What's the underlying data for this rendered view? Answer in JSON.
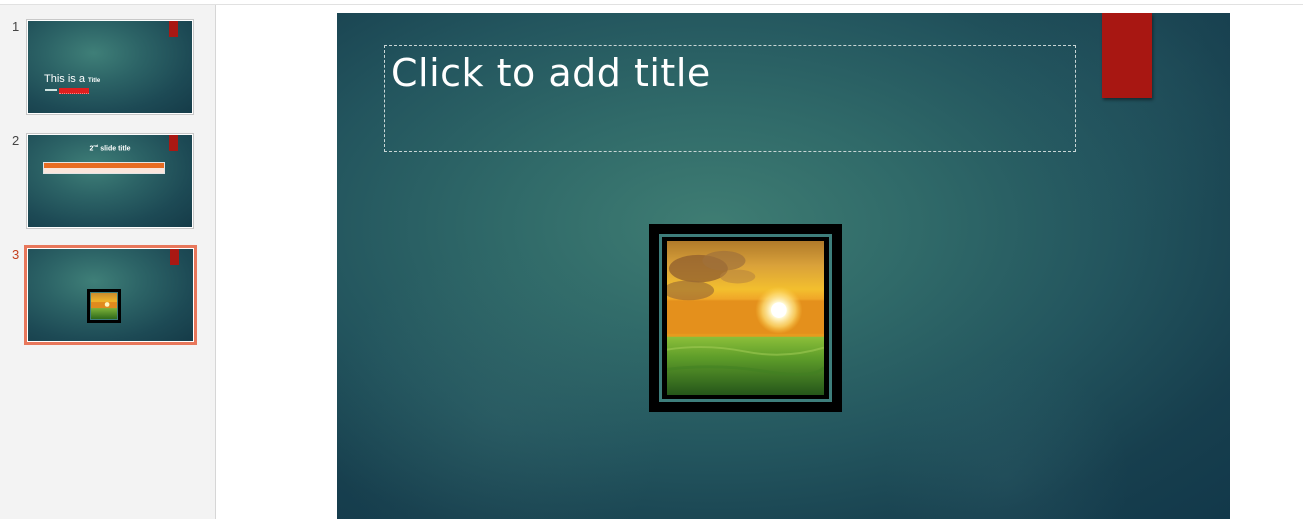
{
  "thumbnails": [
    {
      "number": "1",
      "title_main": "This is a",
      "title_small": "Title"
    },
    {
      "number": "2",
      "title": "2",
      "title_sup": "nd",
      "title_rest": " slide title"
    },
    {
      "number": "3",
      "active": true
    }
  ],
  "slide": {
    "title_placeholder": "Click to add title"
  },
  "colors": {
    "accent_ribbon": "#a81712",
    "active_thumbnail_border": "#e8775b",
    "slide_background": "#2c6366"
  },
  "icons": {
    "picture": "sunset-field-image"
  }
}
